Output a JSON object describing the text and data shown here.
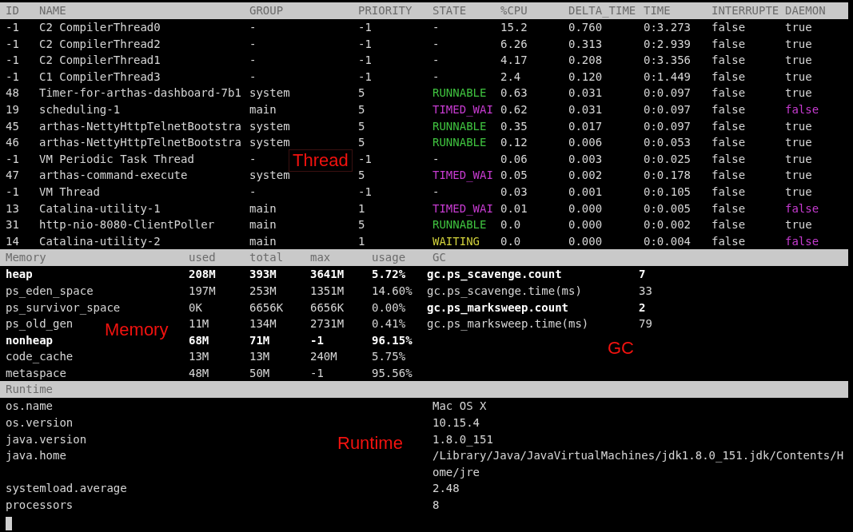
{
  "threads": {
    "columns": [
      "ID",
      "NAME",
      "GROUP",
      "PRIORITY",
      "STATE",
      "%CPU",
      "DELTA_TIME",
      "TIME",
      "INTERRUPTE",
      "DAEMON"
    ],
    "rows": [
      {
        "id": "-1",
        "name": "C2 CompilerThread0",
        "group": "-",
        "priority": "-1",
        "state": {
          "text": "-",
          "color": "#d6d6d6"
        },
        "cpu": "15.2",
        "delta_time": "0.760",
        "time": "0:3.273",
        "interrupted": "false",
        "daemon": {
          "text": "true",
          "color": "#d6d6d6"
        }
      },
      {
        "id": "-1",
        "name": "C2 CompilerThread2",
        "group": "-",
        "priority": "-1",
        "state": {
          "text": "-",
          "color": "#d6d6d6"
        },
        "cpu": "6.26",
        "delta_time": "0.313",
        "time": "0:2.939",
        "interrupted": "false",
        "daemon": {
          "text": "true",
          "color": "#d6d6d6"
        }
      },
      {
        "id": "-1",
        "name": "C2 CompilerThread1",
        "group": "-",
        "priority": "-1",
        "state": {
          "text": "-",
          "color": "#d6d6d6"
        },
        "cpu": "4.17",
        "delta_time": "0.208",
        "time": "0:3.356",
        "interrupted": "false",
        "daemon": {
          "text": "true",
          "color": "#d6d6d6"
        }
      },
      {
        "id": "-1",
        "name": "C1 CompilerThread3",
        "group": "-",
        "priority": "-1",
        "state": {
          "text": "-",
          "color": "#d6d6d6"
        },
        "cpu": "2.4",
        "delta_time": "0.120",
        "time": "0:1.449",
        "interrupted": "false",
        "daemon": {
          "text": "true",
          "color": "#d6d6d6"
        }
      },
      {
        "id": "48",
        "name": "Timer-for-arthas-dashboard-7b1",
        "group": "system",
        "priority": "5",
        "state": {
          "text": "RUNNABLE",
          "color": "#3fc23f"
        },
        "cpu": "0.63",
        "delta_time": "0.031",
        "time": "0:0.097",
        "interrupted": "false",
        "daemon": {
          "text": "true",
          "color": "#d6d6d6"
        }
      },
      {
        "id": "19",
        "name": "scheduling-1",
        "group": "main",
        "priority": "5",
        "state": {
          "text": "TIMED_WAI",
          "color": "#c63bd0"
        },
        "cpu": "0.62",
        "delta_time": "0.031",
        "time": "0:0.097",
        "interrupted": "false",
        "daemon": {
          "text": "false",
          "color": "#c63bd0"
        }
      },
      {
        "id": "45",
        "name": "arthas-NettyHttpTelnetBootstra",
        "group": "system",
        "priority": "5",
        "state": {
          "text": "RUNNABLE",
          "color": "#3fc23f"
        },
        "cpu": "0.35",
        "delta_time": "0.017",
        "time": "0:0.097",
        "interrupted": "false",
        "daemon": {
          "text": "true",
          "color": "#d6d6d6"
        }
      },
      {
        "id": "46",
        "name": "arthas-NettyHttpTelnetBootstra",
        "group": "system",
        "priority": "5",
        "state": {
          "text": "RUNNABLE",
          "color": "#3fc23f"
        },
        "cpu": "0.12",
        "delta_time": "0.006",
        "time": "0:0.053",
        "interrupted": "false",
        "daemon": {
          "text": "true",
          "color": "#d6d6d6"
        }
      },
      {
        "id": "-1",
        "name": "VM Periodic Task Thread",
        "group": "-",
        "priority": "-1",
        "state": {
          "text": "-",
          "color": "#d6d6d6"
        },
        "cpu": "0.06",
        "delta_time": "0.003",
        "time": "0:0.025",
        "interrupted": "false",
        "daemon": {
          "text": "true",
          "color": "#d6d6d6"
        }
      },
      {
        "id": "47",
        "name": "arthas-command-execute",
        "group": "system",
        "priority": "5",
        "state": {
          "text": "TIMED_WAI",
          "color": "#c63bd0"
        },
        "cpu": "0.05",
        "delta_time": "0.002",
        "time": "0:0.178",
        "interrupted": "false",
        "daemon": {
          "text": "true",
          "color": "#d6d6d6"
        }
      },
      {
        "id": "-1",
        "name": "VM Thread",
        "group": "-",
        "priority": "-1",
        "state": {
          "text": "-",
          "color": "#d6d6d6"
        },
        "cpu": "0.03",
        "delta_time": "0.001",
        "time": "0:0.105",
        "interrupted": "false",
        "daemon": {
          "text": "true",
          "color": "#d6d6d6"
        }
      },
      {
        "id": "13",
        "name": "Catalina-utility-1",
        "group": "main",
        "priority": "1",
        "state": {
          "text": "TIMED_WAI",
          "color": "#c63bd0"
        },
        "cpu": "0.01",
        "delta_time": "0.000",
        "time": "0:0.005",
        "interrupted": "false",
        "daemon": {
          "text": "false",
          "color": "#c63bd0"
        }
      },
      {
        "id": "31",
        "name": "http-nio-8080-ClientPoller",
        "group": "main",
        "priority": "5",
        "state": {
          "text": "RUNNABLE",
          "color": "#3fc23f"
        },
        "cpu": "0.0",
        "delta_time": "0.000",
        "time": "0:0.002",
        "interrupted": "false",
        "daemon": {
          "text": "true",
          "color": "#d6d6d6"
        }
      },
      {
        "id": "14",
        "name": "Catalina-utility-2",
        "group": "main",
        "priority": "1",
        "state": {
          "text": "WAITING",
          "color": "#cfcf3a"
        },
        "cpu": "0.0",
        "delta_time": "0.000",
        "time": "0:0.004",
        "interrupted": "false",
        "daemon": {
          "text": "false",
          "color": "#c63bd0"
        }
      }
    ]
  },
  "memory": {
    "columns": [
      "Memory",
      "used",
      "total",
      "max",
      "usage"
    ],
    "rows": [
      {
        "name": "heap",
        "used": "208M",
        "total": "393M",
        "max": "3641M",
        "usage": "5.72%",
        "bold": true
      },
      {
        "name": "ps_eden_space",
        "used": "197M",
        "total": "253M",
        "max": "1351M",
        "usage": "14.60%",
        "bold": false
      },
      {
        "name": "ps_survivor_space",
        "used": "0K",
        "total": "6656K",
        "max": "6656K",
        "usage": "0.00%",
        "bold": false
      },
      {
        "name": "ps_old_gen",
        "used": "11M",
        "total": "134M",
        "max": "2731M",
        "usage": "0.41%",
        "bold": false
      },
      {
        "name": "nonheap",
        "used": "68M",
        "total": "71M",
        "max": "-1",
        "usage": "96.15%",
        "bold": true
      },
      {
        "name": "code_cache",
        "used": "13M",
        "total": "13M",
        "max": "240M",
        "usage": "5.75%",
        "bold": false
      },
      {
        "name": "metaspace",
        "used": "48M",
        "total": "50M",
        "max": "-1",
        "usage": "95.56%",
        "bold": false
      }
    ]
  },
  "gc": {
    "title": "GC",
    "rows": [
      {
        "name": "gc.ps_scavenge.count",
        "value": "7",
        "bold": true
      },
      {
        "name": "gc.ps_scavenge.time(ms)",
        "value": "33",
        "bold": false
      },
      {
        "name": "gc.ps_marksweep.count",
        "value": "2",
        "bold": true
      },
      {
        "name": "gc.ps_marksweep.time(ms)",
        "value": "79",
        "bold": false
      }
    ]
  },
  "runtime": {
    "title": "Runtime",
    "rows": [
      {
        "name": "os.name",
        "value": "Mac OS X"
      },
      {
        "name": "os.version",
        "value": "10.15.4"
      },
      {
        "name": "java.version",
        "value": "1.8.0_151"
      },
      {
        "name": "java.home",
        "value": "/Library/Java/JavaVirtualMachines/jdk1.8.0_151.jdk/Contents/Home/jre"
      },
      {
        "name": "systemload.average",
        "value": "2.48"
      },
      {
        "name": "processors",
        "value": "8"
      }
    ]
  },
  "annotations": [
    {
      "kind": "thread",
      "text": "Thread"
    },
    {
      "kind": "memory",
      "text": "Memory"
    },
    {
      "kind": "gc",
      "text": "GC"
    },
    {
      "kind": "runtime",
      "text": "Runtime"
    }
  ]
}
